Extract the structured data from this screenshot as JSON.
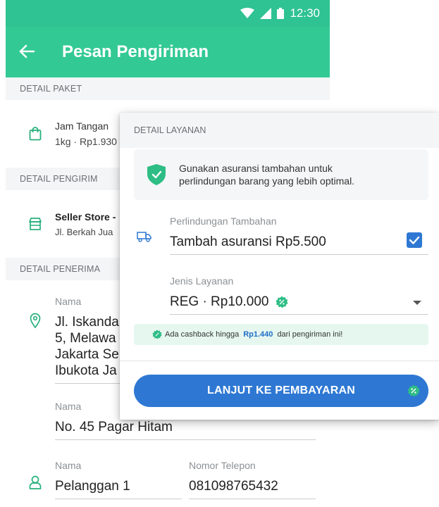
{
  "status_bar": {
    "time": "12:30",
    "icons": [
      "wifi-icon",
      "signal-icon",
      "battery-icon"
    ]
  },
  "app_bar": {
    "title": "Pesan Pengiriman",
    "back_icon": "arrow-left-icon"
  },
  "sections": {
    "paket": {
      "label": "DETAIL PAKET",
      "item_name": "Jam Tangan",
      "item_detail": "1kg · Rp1.930"
    },
    "pengirim": {
      "label": "DETAIL PENGIRIM",
      "name": "Seller Store -",
      "address": "Jl. Berkah Jua"
    },
    "penerima": {
      "label": "DETAIL PENERIMA",
      "address_label": "Nama",
      "address_lines": [
        "Jl. Iskanda",
        "5, Melawa",
        "Jakarta Se",
        "Ibukota Ja"
      ],
      "detail_label": "Nama",
      "detail_value": "No. 45 Pagar Hitam",
      "name_label": "Nama",
      "name_value": "Pelanggan 1",
      "phone_label": "Nomor Telepon",
      "phone_value": "081098765432"
    }
  },
  "dialog": {
    "header": "DETAIL LAYANAN",
    "insurance_notice": "Gunakan asuransi tambahan untuk perlindungan barang yang lebih optimal.",
    "perlindungan_label": "Perlindungan Tambahan",
    "perlindungan_value": "Tambah asuransi Rp5.500",
    "perlindungan_checked": true,
    "jenis_label": "Jenis Layanan",
    "jenis_value": "REG · Rp10.000",
    "cashback_prefix": "Ada cashback hingga",
    "cashback_amount": "Rp1.440",
    "cashback_suffix": "dari pengiriman ini!",
    "cta_label": "LANJUT KE PEMBAYARAN"
  },
  "colors": {
    "primary_green": "#33c995",
    "status_green": "#2fc292",
    "blue": "#2e78d3",
    "badge_green": "#2ebd85",
    "checkbox_blue": "#2e78d3"
  }
}
